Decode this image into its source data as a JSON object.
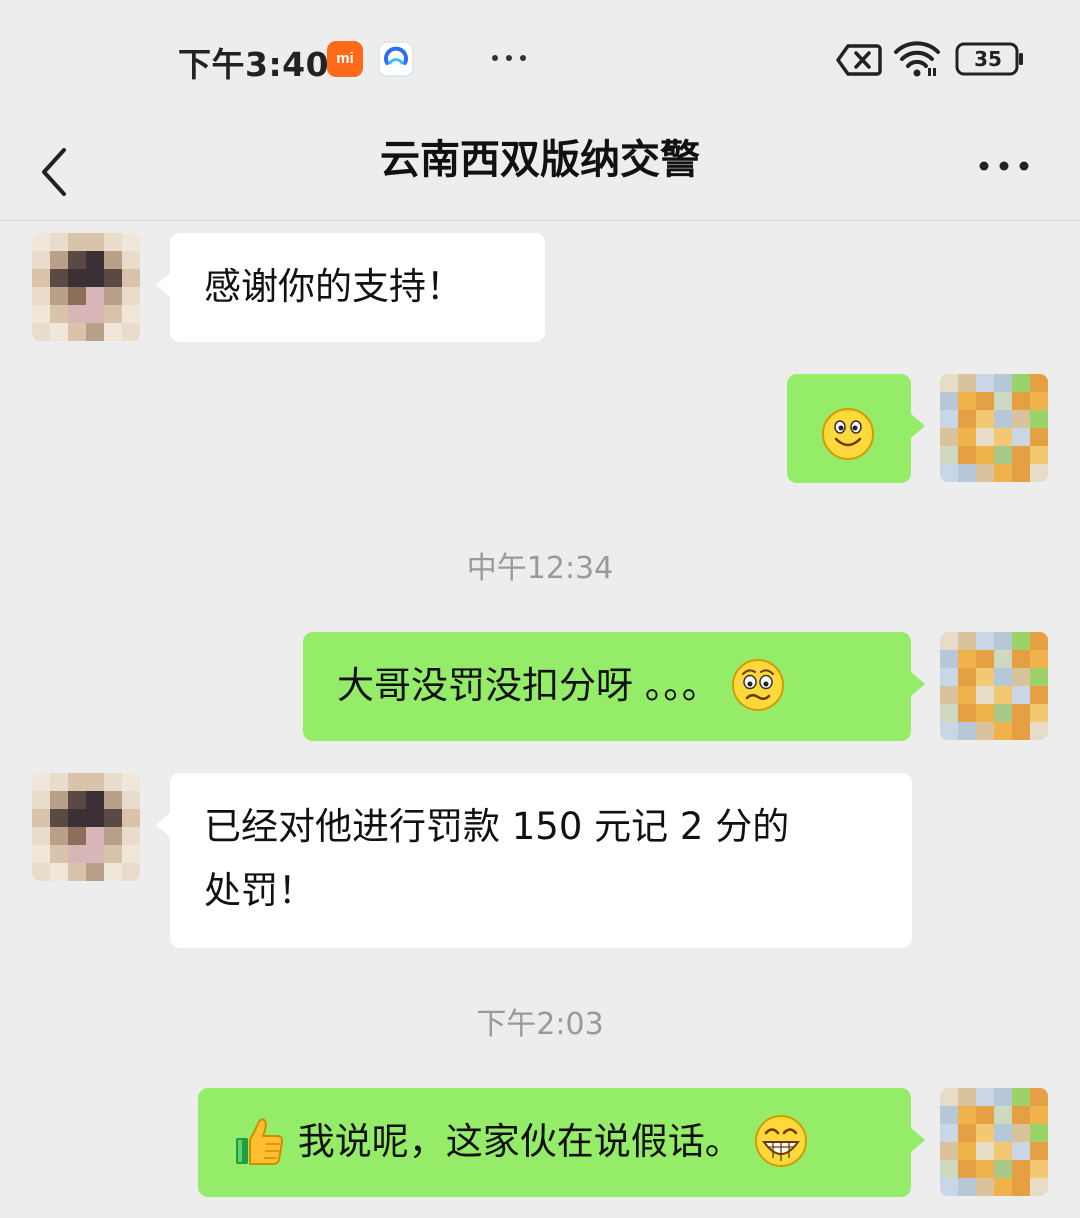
{
  "status_bar": {
    "time": "下午3:40",
    "mi_badge": "mi",
    "battery": "35",
    "icons": [
      "mi-app-icon",
      "browser-app-icon",
      "more-dots-icon",
      "no-sim-icon",
      "wifi-icon",
      "battery-icon"
    ]
  },
  "header": {
    "title": "云南西双版纳交警",
    "back_icon": "chevron-left-icon",
    "more_icon": "more-dots-icon"
  },
  "messages": [
    {
      "sender": "contact",
      "text": "感谢你的支持！"
    },
    {
      "sender": "me",
      "emoji": "smile-emoji"
    },
    {
      "type": "timestamp",
      "text": "中午12:34"
    },
    {
      "sender": "me",
      "text": "大哥没罚没扣分呀 。。。",
      "emoji": "worried-emoji"
    },
    {
      "sender": "contact",
      "text_line1": "已经对他进行罚款 150 元记 2 分的",
      "text_line2": "处罚！"
    },
    {
      "type": "timestamp",
      "text": "下午2:03"
    },
    {
      "sender": "me",
      "lead_emoji": "thumbs-up-emoji",
      "text": "我说呢，这家伙在说假话。",
      "emoji": "grin-emoji"
    }
  ],
  "colors": {
    "background": "#ededed",
    "incoming_bubble": "#ffffff",
    "outgoing_bubble": "#95ec69",
    "timestamp_text": "#9a9a9a",
    "mi_orange": "#ff6a1a"
  }
}
